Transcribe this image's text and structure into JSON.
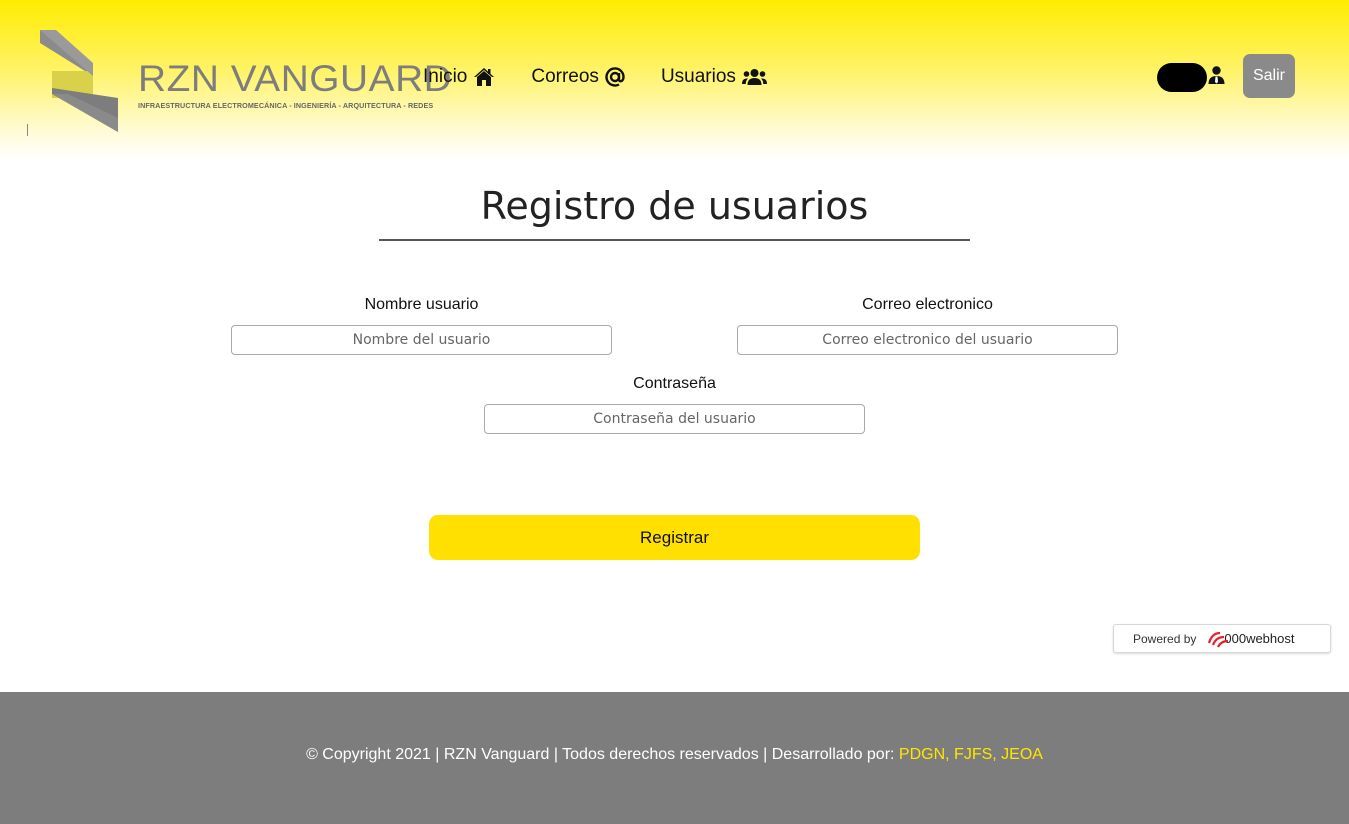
{
  "brand": {
    "name": "RZN VANGUARD",
    "tagline": "INFRAESTRUCTURA ELECTROMECÁNICA - INGENIERÍA - ARQUITECTURA - REDES"
  },
  "nav": {
    "items": [
      {
        "label": "Inicio",
        "icon": "home-icon"
      },
      {
        "label": "Correos",
        "icon": "at-icon"
      },
      {
        "label": "Usuarios",
        "icon": "users-icon"
      }
    ]
  },
  "header": {
    "logout_label": "Salir",
    "toggle_icon": "toggle-icon",
    "profile_icon": "user-tie-icon"
  },
  "form": {
    "title": "Registro de usuarios",
    "username": {
      "label": "Nombre usuario",
      "placeholder": "Nombre del usuario",
      "value": ""
    },
    "email": {
      "label": "Correo electronico",
      "placeholder": "Correo electronico del usuario",
      "value": ""
    },
    "password": {
      "label": "Contraseña",
      "placeholder": "Contraseña del usuario",
      "value": ""
    },
    "submit_label": "Registrar"
  },
  "badge": {
    "prefix": "Powered by",
    "brand": "000webhost"
  },
  "footer": {
    "text": "© Copyright 2021 | RZN Vanguard | Todos derechos reservados | Desarrollado por: ",
    "authors": "PDGN, FJFS, JEOA"
  },
  "colors": {
    "accent_yellow": "#ffe000",
    "footer_gray": "#7d7d7d",
    "logout_gray": "#8a8a8a"
  }
}
